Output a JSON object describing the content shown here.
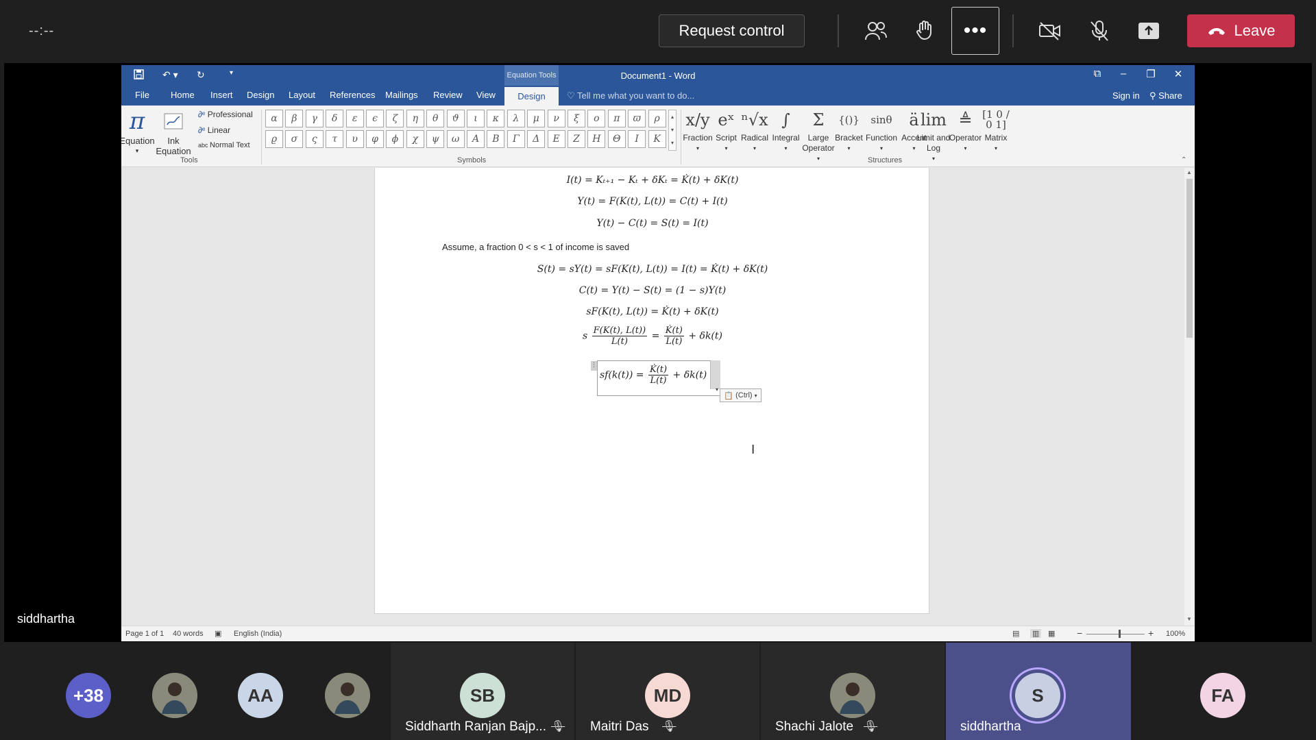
{
  "meeting": {
    "timer": "--:--",
    "request_control": "Request control",
    "leave": "Leave",
    "more": "•••",
    "presenter_name": "siddhartha"
  },
  "word": {
    "title": "Document1 - Word",
    "equation_tools": "Equation Tools",
    "tabs": [
      "File",
      "Home",
      "Insert",
      "Design",
      "Layout",
      "References",
      "Mailings",
      "Review",
      "View"
    ],
    "active_tab": "Design",
    "tell_me": "Tell me what you want to do...",
    "sign_in": "Sign in",
    "share": "Share",
    "tools": {
      "equation": "Equation",
      "ink_equation_1": "Ink",
      "ink_equation_2": "Equation",
      "professional": "Professional",
      "linear": "Linear",
      "normal_text": "Normal Text",
      "group_label": "Tools"
    },
    "symbols": {
      "row1": [
        "α",
        "β",
        "γ",
        "δ",
        "ε",
        "ϵ",
        "ζ",
        "η",
        "θ",
        "ϑ",
        "ι",
        "κ",
        "λ",
        "μ",
        "ν",
        "ξ",
        "ο",
        "π",
        "ϖ",
        "ρ"
      ],
      "row2": [
        "ϱ",
        "σ",
        "ς",
        "τ",
        "υ",
        "φ",
        "ϕ",
        "χ",
        "ψ",
        "ω",
        "Α",
        "Β",
        "Γ",
        "Δ",
        "Ε",
        "Ζ",
        "Η",
        "Θ",
        "Ι",
        "Κ"
      ],
      "group_label": "Symbols"
    },
    "structures": {
      "items": [
        {
          "label": "Fraction",
          "glyph": "x/y"
        },
        {
          "label": "Script",
          "glyph": "eˣ"
        },
        {
          "label": "Radical",
          "glyph": "ⁿ√x"
        },
        {
          "label": "Integral",
          "glyph": "∫"
        },
        {
          "label": "Large Operator",
          "glyph": "Σ"
        },
        {
          "label": "Bracket",
          "glyph": "{()}"
        },
        {
          "label": "Function",
          "glyph": "sinθ"
        },
        {
          "label": "Accent",
          "glyph": "ä"
        },
        {
          "label": "Limit and Log",
          "glyph": "lim"
        },
        {
          "label": "Operator",
          "glyph": "≜"
        },
        {
          "label": "Matrix",
          "glyph": "[1 0 / 0 1]"
        }
      ],
      "group_label": "Structures"
    },
    "document": {
      "eq1": "I(t) = Kₜ₊₁ − Kₜ + δKₜ = K̇(t) + δK(t)",
      "eq2": "Y(t) = F(K(t), L(t)) = C(t) + I(t)",
      "eq3": "Y(t) − C(t) = S(t) = I(t)",
      "assume_text": "Assume, a fraction 0 < s < 1 of income is saved",
      "eq4": "S(t) = sY(t) = sF(K(t), L(t)) = I(t) = K̇(t) + δK(t)",
      "eq5": "C(t) = Y(t) − S(t) = (1 − s)Y(t)",
      "eq6": "sF(K(t), L(t)) = K̇(t) + δK(t)",
      "eq7_lhs_prefix": "s",
      "eq7_num": "F(K(t), L(t))",
      "eq7_den": "L(t)",
      "eq7_mid": "=",
      "eq7_num2": "K̇(t)",
      "eq7_den2": "L(t)",
      "eq7_tail": "+ δk(t)",
      "eq8_lhs": "sf(k(t)) =",
      "eq8_num": "K̇(t)",
      "eq8_den": "L(t)",
      "eq8_tail": "+ δk(t)",
      "paste_options": "(Ctrl)"
    },
    "status": {
      "page": "Page 1 of 1",
      "words": "40 words",
      "language": "English (India)",
      "zoom": "100%"
    }
  },
  "participants": [
    {
      "initials": "+38",
      "color": "#5b5fc7"
    },
    {
      "initials": "",
      "color": "#6b6b6b"
    },
    {
      "initials": "AA",
      "color": "#c9d6e8"
    },
    {
      "initials": "",
      "color": "#6b6b6b"
    },
    {
      "initials": "SB",
      "name": "Siddharth Ranjan Bajp...",
      "color": "#cde0d5"
    },
    {
      "initials": "MD",
      "name": "Maitri Das",
      "color": "#f6d9d3"
    },
    {
      "initials": "",
      "name": "Shachi Jalote",
      "color": "#6b6b6b"
    },
    {
      "initials": "S",
      "name": "siddhartha",
      "color": "#c8cfe2"
    },
    {
      "initials": "FA",
      "color": "#f3d4e4"
    }
  ]
}
